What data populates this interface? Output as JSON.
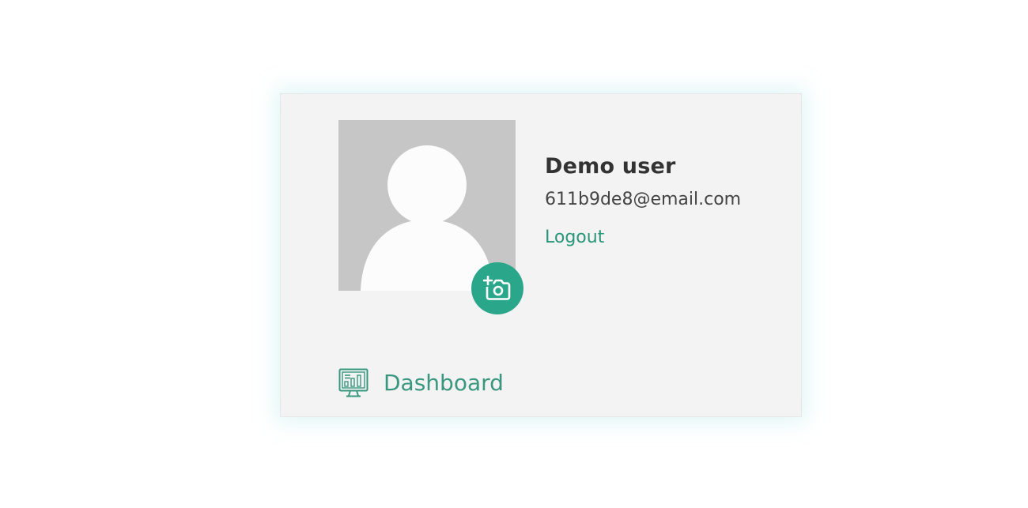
{
  "profile": {
    "name": "Demo user",
    "email": "611b9de8@email.com",
    "logout_label": "Logout",
    "avatar_icon": "default-user-silhouette",
    "camera_icon": "add-photo-camera-icon"
  },
  "nav": {
    "dashboard_label": "Dashboard",
    "dashboard_icon": "dashboard-monitor-chart-icon"
  },
  "colors": {
    "accent": "#2aa68a",
    "link": "#2a9579",
    "card_background": "#f3f3f3",
    "avatar_background": "#c6c6c6"
  }
}
